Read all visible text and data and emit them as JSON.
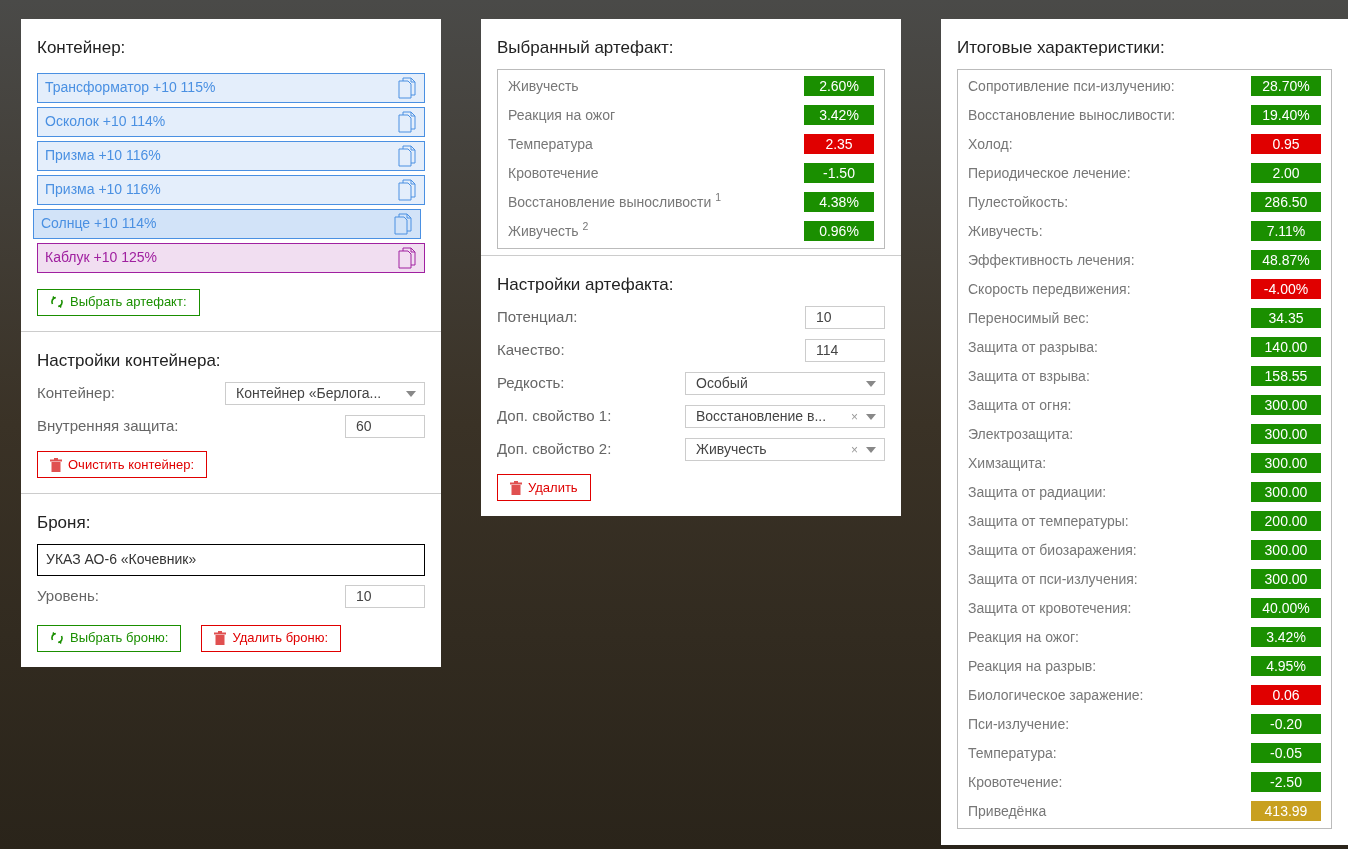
{
  "container_panel": {
    "title": "Контейнер:",
    "artifacts": [
      {
        "label": "Трансформатор +10 115%",
        "color": "#4a90e2",
        "selected": false
      },
      {
        "label": "Осколок +10 114%",
        "color": "#4a90e2",
        "selected": false
      },
      {
        "label": "Призма +10 116%",
        "color": "#4a90e2",
        "selected": false
      },
      {
        "label": "Призма +10 116%",
        "color": "#4a90e2",
        "selected": false
      },
      {
        "label": "Солнце +10 114%",
        "color": "#4a90e2",
        "selected": true
      },
      {
        "label": "Каблук +10 125%",
        "color": "#a020a0",
        "selected": false
      }
    ],
    "choose_button": "Выбрать артефакт:"
  },
  "container_settings": {
    "title": "Настройки контейнера:",
    "fields": [
      {
        "kind": "select",
        "label": "Контейнер:",
        "value": "Контейнер «Берлога..."
      },
      {
        "kind": "input",
        "label": "Внутренняя защита:",
        "value": "60"
      }
    ],
    "clear_button": "Очистить контейнер:"
  },
  "armor": {
    "title": "Броня:",
    "name": "УКАЗ АО-6 «Кочевник»",
    "fields": [
      {
        "kind": "input",
        "label": "Уровень:",
        "value": "10"
      }
    ],
    "choose_button": "Выбрать броню:",
    "delete_button": "Удалить броню:"
  },
  "selected_artifact": {
    "title": "Выбранный артефакт:",
    "stats": [
      {
        "label": "Живучесть",
        "value": "2.60%",
        "kind": "good"
      },
      {
        "label": "Реакция на ожог",
        "value": "3.42%",
        "kind": "good"
      },
      {
        "label": "Температура",
        "value": "2.35",
        "kind": "bad"
      },
      {
        "label": "Кровотечение",
        "value": "-1.50",
        "kind": "good"
      },
      {
        "label": "Восстановление выносливости $^{1}$",
        "value": "4.38%",
        "kind": "good"
      },
      {
        "label": "Живучесть $^{2}$",
        "value": "0.96%",
        "kind": "good"
      }
    ]
  },
  "artifact_settings": {
    "title": "Настройки артефакта:",
    "fields": [
      {
        "kind": "input",
        "label": "Потенциал:",
        "value": "10"
      },
      {
        "kind": "input",
        "label": "Качество:",
        "value": "114"
      },
      {
        "kind": "select",
        "label": "Редкость:",
        "value": "Особый"
      },
      {
        "kind": "select",
        "label": "Доп. свойство 1:",
        "value": "Восстановление в...",
        "clear": "×"
      },
      {
        "kind": "select",
        "label": "Доп. свойство 2:",
        "value": "Живучесть",
        "clear": "×"
      }
    ],
    "delete_button": "Удалить"
  },
  "totals": {
    "title": "Итоговые характеристики:",
    "stats": [
      {
        "label": "Сопротивление пси-излучению:",
        "value": "28.70%",
        "kind": "good"
      },
      {
        "label": "Восстановление выносливости:",
        "value": "19.40%",
        "kind": "good"
      },
      {
        "label": "Холод:",
        "value": "0.95",
        "kind": "bad"
      },
      {
        "label": "Периодическое лечение:",
        "value": "2.00",
        "kind": "good"
      },
      {
        "label": "Пулестойкость:",
        "value": "286.50",
        "kind": "good"
      },
      {
        "label": "Живучесть:",
        "value": "7.11%",
        "kind": "good"
      },
      {
        "label": "Эффективность лечения:",
        "value": "48.87%",
        "kind": "good"
      },
      {
        "label": "Скорость передвижения:",
        "value": "-4.00%",
        "kind": "bad"
      },
      {
        "label": "Переносимый вес:",
        "value": "34.35",
        "kind": "good"
      },
      {
        "label": "Защита от разрыва:",
        "value": "140.00",
        "kind": "good"
      },
      {
        "label": "Защита от взрыва:",
        "value": "158.55",
        "kind": "good"
      },
      {
        "label": "Защита от огня:",
        "value": "300.00",
        "kind": "good"
      },
      {
        "label": "Электрозащита:",
        "value": "300.00",
        "kind": "good"
      },
      {
        "label": "Химзащита:",
        "value": "300.00",
        "kind": "good"
      },
      {
        "label": "Защита от радиации:",
        "value": "300.00",
        "kind": "good"
      },
      {
        "label": "Защита от температуры:",
        "value": "200.00",
        "kind": "good"
      },
      {
        "label": "Защита от биозаражения:",
        "value": "300.00",
        "kind": "good"
      },
      {
        "label": "Защита от пси-излучения:",
        "value": "300.00",
        "kind": "good"
      },
      {
        "label": "Защита от кровотечения:",
        "value": "40.00%",
        "kind": "good"
      },
      {
        "label": "Реакция на ожог:",
        "value": "3.42%",
        "kind": "good"
      },
      {
        "label": "Реакция на разрыв:",
        "value": "4.95%",
        "kind": "good"
      },
      {
        "label": "Биологическое заражение:",
        "value": "0.06",
        "kind": "bad"
      },
      {
        "label": "Пси-излучение:",
        "value": "-0.20",
        "kind": "good"
      },
      {
        "label": "Температура:",
        "value": "-0.05",
        "kind": "good"
      },
      {
        "label": "Кровотечение:",
        "value": "-2.50",
        "kind": "good"
      },
      {
        "label": "Приведёнка",
        "value": "413.99",
        "kind": "total"
      }
    ]
  }
}
